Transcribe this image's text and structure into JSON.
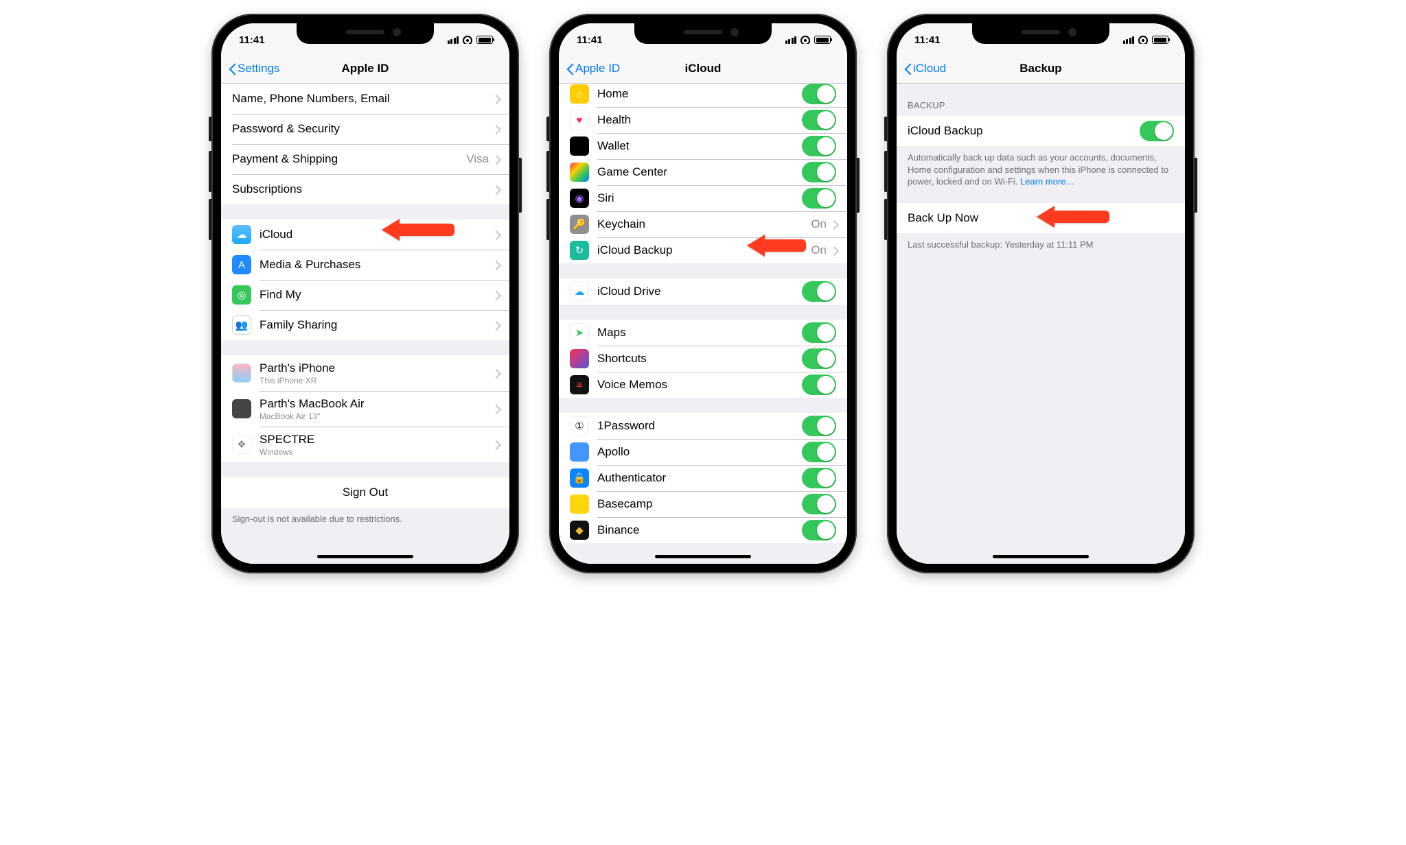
{
  "status": {
    "time": "11:41"
  },
  "phone1": {
    "back": "Settings",
    "title": "Apple ID",
    "rows_account": [
      {
        "label": "Name, Phone Numbers, Email",
        "detail": ""
      },
      {
        "label": "Password & Security",
        "detail": ""
      },
      {
        "label": "Payment & Shipping",
        "detail": "Visa"
      },
      {
        "label": "Subscriptions",
        "detail": ""
      }
    ],
    "rows_services": [
      {
        "label": "iCloud",
        "key": "icloud"
      },
      {
        "label": "Media & Purchases",
        "key": "appstore"
      },
      {
        "label": "Find My",
        "key": "findmy"
      },
      {
        "label": "Family Sharing",
        "key": "family"
      }
    ],
    "rows_devices": [
      {
        "label": "Parth's iPhone",
        "sub": "This iPhone XR",
        "key": "device"
      },
      {
        "label": "Parth's MacBook Air",
        "sub": "MacBook Air 13\"",
        "key": "mac"
      },
      {
        "label": "SPECTRE",
        "sub": "Windows",
        "key": "windows"
      }
    ],
    "sign_out": "Sign Out",
    "footer": "Sign-out is not available due to restrictions."
  },
  "phone2": {
    "back": "Apple ID",
    "title": "iCloud",
    "rows_apps_top": [
      {
        "label": "Home",
        "key": "home",
        "toggle": true
      },
      {
        "label": "Health",
        "key": "health",
        "toggle": true
      },
      {
        "label": "Wallet",
        "key": "wallet",
        "toggle": true
      },
      {
        "label": "Game Center",
        "key": "gamecenter",
        "toggle": true
      },
      {
        "label": "Siri",
        "key": "siri",
        "toggle": true
      },
      {
        "label": "Keychain",
        "key": "keychain",
        "detail": "On"
      },
      {
        "label": "iCloud Backup",
        "key": "icloudbackup",
        "detail": "On"
      }
    ],
    "rows_drive": [
      {
        "label": "iCloud Drive",
        "key": "iclouddrive",
        "toggle": true
      }
    ],
    "rows_apps_mid": [
      {
        "label": "Maps",
        "key": "maps",
        "toggle": true
      },
      {
        "label": "Shortcuts",
        "key": "shortcuts",
        "toggle": true
      },
      {
        "label": "Voice Memos",
        "key": "voicememos",
        "toggle": true
      }
    ],
    "rows_apps_third": [
      {
        "label": "1Password",
        "key": "1password",
        "toggle": true
      },
      {
        "label": "Apollo",
        "key": "apollo",
        "toggle": true
      },
      {
        "label": "Authenticator",
        "key": "authenticator",
        "toggle": true
      },
      {
        "label": "Basecamp",
        "key": "basecamp",
        "toggle": true
      },
      {
        "label": "Binance",
        "key": "binance",
        "toggle": true
      }
    ]
  },
  "phone3": {
    "back": "iCloud",
    "title": "Backup",
    "section_header": "Backup",
    "toggle_label": "iCloud Backup",
    "footer_text": "Automatically back up data such as your accounts, documents, Home configuration and settings when this iPhone is connected to power, locked and on Wi-Fi. ",
    "footer_link": "Learn more…",
    "backup_now": "Back Up Now",
    "last_backup": "Last successful backup: Yesterday at 11:11 PM"
  },
  "icon_glyphs": {
    "cloud": "☁︎",
    "appstore": "A",
    "findmy": "◎",
    "family": "👥",
    "home": "⌂",
    "health": "♥",
    "wallet": "▭",
    "gamecenter": "✦",
    "siri": "◉",
    "keychain": "🔑",
    "icloudbackup": "↻",
    "iclouddrive": "☁︎",
    "maps": "➤",
    "shortcuts": "❖",
    "voicememos": "≡",
    "1password": "①",
    "apollo": "👽",
    "authenticator": "🔒",
    "basecamp": "⌂",
    "binance": "◆",
    "device": "",
    "mac": "",
    "windows": "❖"
  }
}
